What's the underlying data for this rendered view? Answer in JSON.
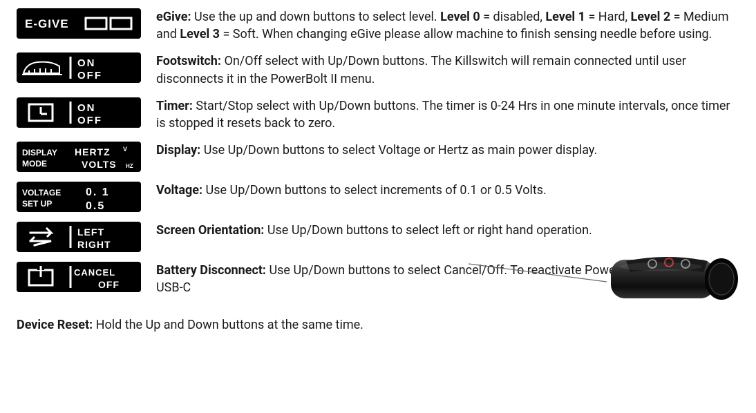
{
  "items": [
    {
      "icon": "egive",
      "title": "eGive:",
      "body_html": "Use the up and down buttons to select level. <b>Level 0</b> = disabled, <b>Level 1</b> = Hard, <b>Level 2</b> = Medium and <b>Level 3</b> = Soft. When changing eGive please allow machine to finish sensing needle before using."
    },
    {
      "icon": "footswitch",
      "title": "Footswitch:",
      "body_html": "On/Off select with Up/Down buttons. The Killswitch will remain connected until user disconnects it in the PowerBolt II menu."
    },
    {
      "icon": "timer",
      "title": "Timer:",
      "body_html": "Start/Stop select with Up/Down buttons. The timer is 0-24 Hrs in one minute intervals, once timer is stopped it resets back to zero."
    },
    {
      "icon": "display",
      "title": "Display:",
      "body_html": "Use Up/Down buttons to select Voltage or Hertz as main power display."
    },
    {
      "icon": "voltage",
      "title": "Voltage:",
      "body_html": "Use Up/Down buttons to select increments of 0.1 or 0.5 Volts."
    },
    {
      "icon": "orientation",
      "title": "Screen Orientation:",
      "body_html": "Use Up/Down buttons to select left or right hand operation."
    },
    {
      "icon": "battery",
      "title": "Battery Disconnect:",
      "body_html": "Use Up/Down buttons to select Cancel/Off. To reactivate PowerBolt II, plug into any USB-C"
    }
  ],
  "footer": {
    "title": "Device Reset:",
    "body": "Hold the Up and Down buttons at the same time."
  },
  "icon_labels": {
    "egive": "E-GIVE",
    "footswitch_on": "ON",
    "footswitch_off": "OFF",
    "timer_on": "ON",
    "timer_off": "OFF",
    "display_mode": "DISPLAY MODE",
    "display_hertz": "HERTZ",
    "display_volts": "VOLTS",
    "display_hz": "HZ",
    "display_v": "V",
    "voltage_setup": "VOLTAGE SET UP",
    "voltage_01": "0.1",
    "voltage_05": "0.5",
    "orient_left": "LEFT",
    "orient_right": "RIGHT",
    "battery_cancel": "CANCEL",
    "battery_off": "OFF"
  }
}
